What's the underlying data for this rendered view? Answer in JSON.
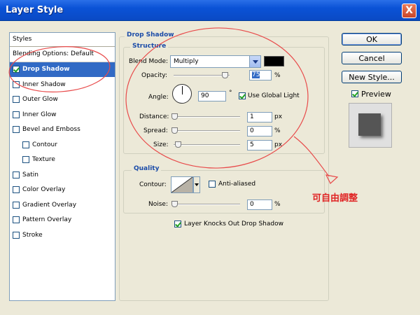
{
  "window": {
    "title": "Layer Style",
    "close_label": "X"
  },
  "styles_list": {
    "header": "Styles",
    "items": [
      {
        "label": "Blending Options: Default",
        "has_checkbox": false
      },
      {
        "label": "Drop Shadow",
        "checked": true
      },
      {
        "label": "Inner Shadow",
        "checked": false
      },
      {
        "label": "Outer Glow",
        "checked": false
      },
      {
        "label": "Inner Glow",
        "checked": false
      },
      {
        "label": "Bevel and Emboss",
        "checked": false
      },
      {
        "label": "Contour",
        "checked": false
      },
      {
        "label": "Texture",
        "checked": false
      },
      {
        "label": "Satin",
        "checked": false
      },
      {
        "label": "Color Overlay",
        "checked": false
      },
      {
        "label": "Gradient Overlay",
        "checked": false
      },
      {
        "label": "Pattern Overlay",
        "checked": false
      },
      {
        "label": "Stroke",
        "checked": false
      }
    ]
  },
  "drop_shadow": {
    "title": "Drop Shadow",
    "structure": {
      "title": "Structure",
      "blend_mode_label": "Blend Mode:",
      "blend_mode_value": "Multiply",
      "shadow_color": "#000000",
      "opacity_label": "Opacity:",
      "opacity_value": "75",
      "opacity_unit": "%",
      "angle_label": "Angle:",
      "angle_value": "90",
      "angle_unit": "°",
      "global_light_label": "Use Global Light",
      "global_light_checked": true,
      "distance_label": "Distance:",
      "distance_value": "1",
      "distance_unit": "px",
      "spread_label": "Spread:",
      "spread_value": "0",
      "spread_unit": "%",
      "size_label": "Size:",
      "size_value": "5",
      "size_unit": "px"
    },
    "quality": {
      "title": "Quality",
      "contour_label": "Contour:",
      "anti_aliased_label": "Anti-aliased",
      "anti_aliased_checked": false,
      "noise_label": "Noise:",
      "noise_value": "0",
      "noise_unit": "%"
    },
    "knockout_label": "Layer Knocks Out Drop Shadow",
    "knockout_checked": true
  },
  "buttons": {
    "ok": "OK",
    "cancel": "Cancel",
    "new_style": "New Style...",
    "preview_label": "Preview",
    "preview_checked": true
  },
  "annotation": {
    "text": "可自由調整",
    "color": "#e02424"
  }
}
